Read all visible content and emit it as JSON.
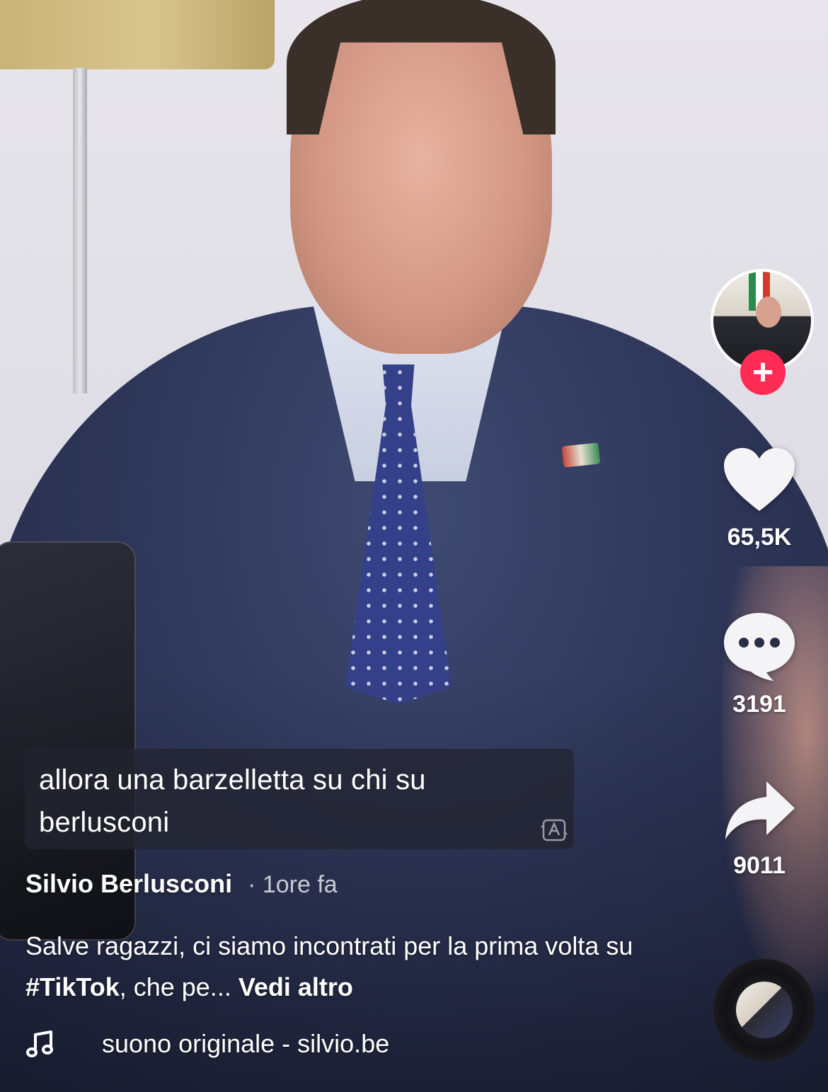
{
  "creator": {
    "name": "Silvio Berlusconi",
    "time_ago": "· 1ore fa",
    "follow_label": "+"
  },
  "subtitle": {
    "text": "allora una barzelletta su chi su berlusconi"
  },
  "description": {
    "prefix": "Salve ragazzi, ci siamo incontrati per la prima volta su ",
    "hashtag": "#TikTok",
    "suffix": ", che pe... ",
    "see_more": "Vedi altro"
  },
  "actions": {
    "likes": "65,5K",
    "comments": "3191",
    "shares": "9011"
  },
  "sound": {
    "label": "suono originale - silvio.be"
  },
  "colors": {
    "follow_accent": "#fe2c55",
    "icon_fill": "#ffffff"
  },
  "icons": [
    "heart-icon",
    "comment-bubble-icon",
    "share-arrow-icon",
    "music-note-icon",
    "translate-icon",
    "plus-icon"
  ]
}
